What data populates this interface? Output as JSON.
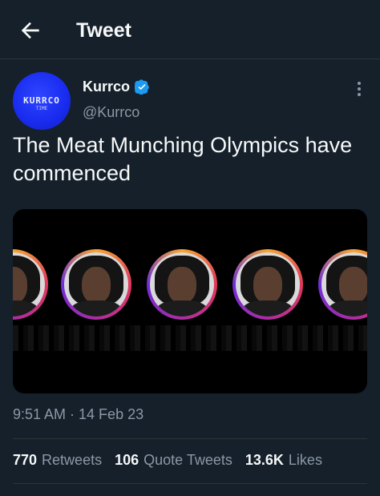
{
  "header": {
    "title": "Tweet",
    "back_icon": "arrow-left-icon"
  },
  "author": {
    "display_name": "Kurrco",
    "handle": "@Kurrco",
    "verified_icon": "verified-badge-icon",
    "avatar_text": "KURRCO",
    "avatar_sub": "TIME"
  },
  "tweet": {
    "text": "The Meat Munching Olympics have commenced",
    "media_description_icon": "image-thumbnail",
    "timestamp": "9:51 AM · 14 Feb 23"
  },
  "stats": [
    {
      "value": "770",
      "label": "Retweets"
    },
    {
      "value": "106",
      "label": "Quote Tweets"
    },
    {
      "value": "13.6K",
      "label": "Likes"
    }
  ],
  "colors": {
    "background": "#15202b",
    "text": "#f7f9f9",
    "secondary": "#8b98a5",
    "accent": "#1d9bf0",
    "divider": "#2f3336"
  }
}
